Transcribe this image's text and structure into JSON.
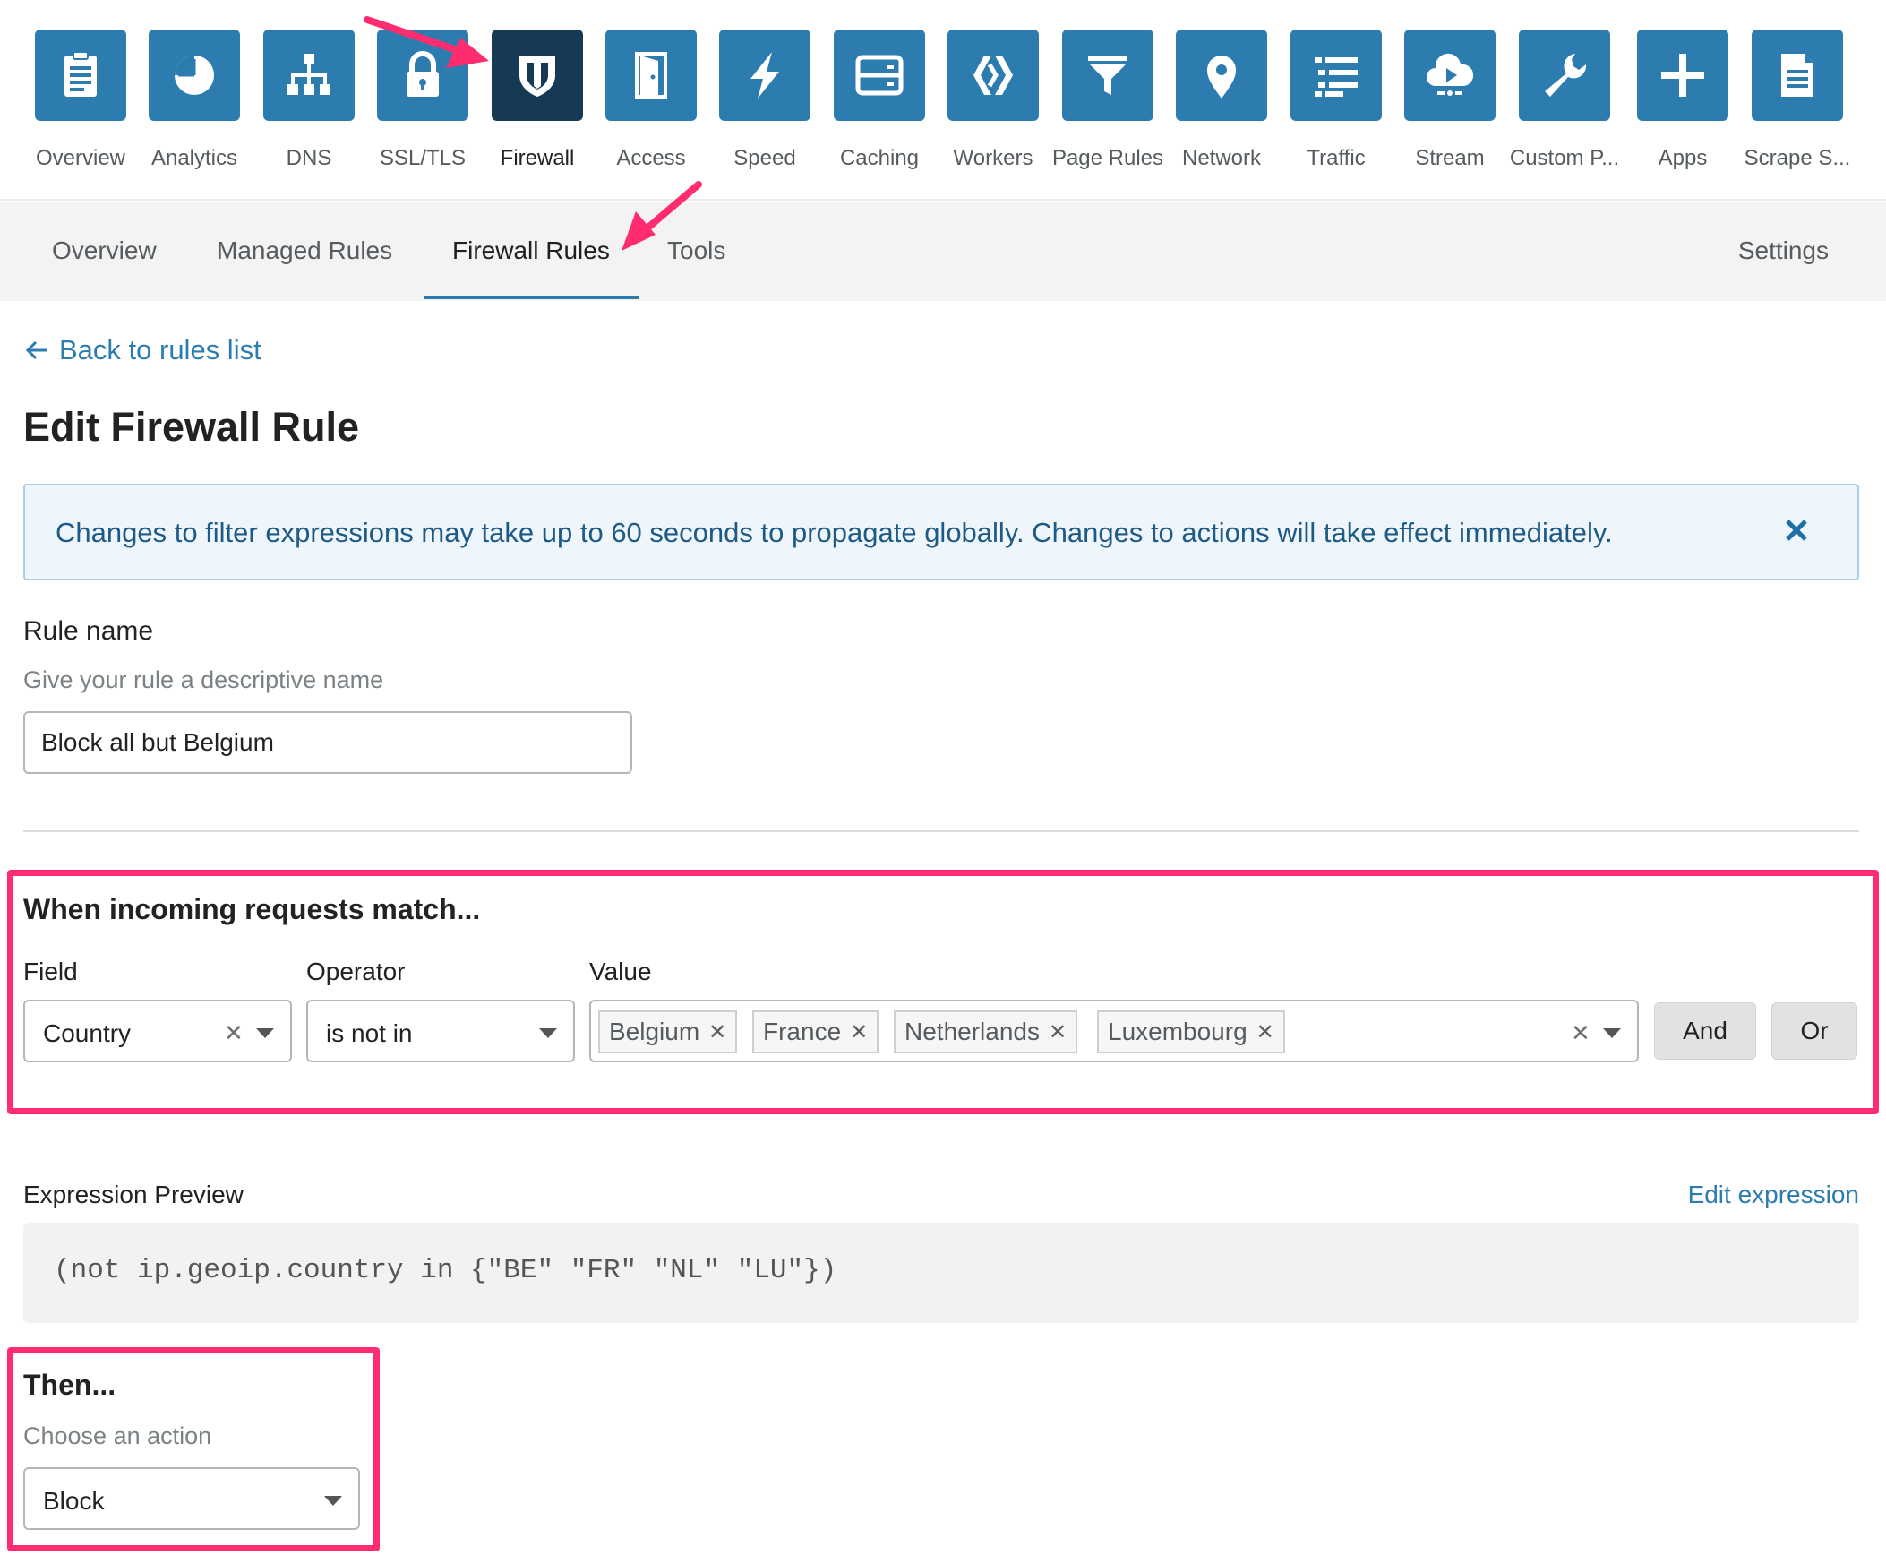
{
  "nav": {
    "items": [
      {
        "label": "Overview",
        "icon": "clipboard-icon"
      },
      {
        "label": "Analytics",
        "icon": "pie-chart-icon"
      },
      {
        "label": "DNS",
        "icon": "network-tree-icon"
      },
      {
        "label": "SSL/TLS",
        "icon": "lock-icon"
      },
      {
        "label": "Firewall",
        "icon": "shield-icon",
        "active": true
      },
      {
        "label": "Access",
        "icon": "door-icon"
      },
      {
        "label": "Speed",
        "icon": "lightning-icon"
      },
      {
        "label": "Caching",
        "icon": "server-icon"
      },
      {
        "label": "Workers",
        "icon": "workers-icon"
      },
      {
        "label": "Page Rules",
        "icon": "filter-icon"
      },
      {
        "label": "Network",
        "icon": "map-pin-icon"
      },
      {
        "label": "Traffic",
        "icon": "list-icon"
      },
      {
        "label": "Stream",
        "icon": "cloud-play-icon"
      },
      {
        "label": "Custom P...",
        "icon": "wrench-icon"
      },
      {
        "label": "Apps",
        "icon": "plus-icon"
      },
      {
        "label": "Scrape S...",
        "icon": "document-icon"
      }
    ]
  },
  "subnav": {
    "tabs": [
      "Overview",
      "Managed Rules",
      "Firewall Rules",
      "Tools"
    ],
    "active": "Firewall Rules",
    "settings": "Settings"
  },
  "back_link": "Back to rules list",
  "page_title": "Edit Firewall Rule",
  "notice": {
    "text": "Changes to filter expressions may take up to 60 seconds to propagate globally. Changes to actions will take effect immediately."
  },
  "rule_name": {
    "label": "Rule name",
    "hint": "Give your rule a descriptive name",
    "value": "Block all but Belgium"
  },
  "match": {
    "title": "When incoming requests match...",
    "field_label": "Field",
    "operator_label": "Operator",
    "value_label": "Value",
    "field": "Country",
    "operator": "is not in",
    "values": [
      "Belgium",
      "France",
      "Netherlands",
      "Luxembourg"
    ],
    "and_label": "And",
    "or_label": "Or"
  },
  "expression": {
    "label": "Expression Preview",
    "edit_label": "Edit expression",
    "code": "(not ip.geoip.country in {\"BE\" \"FR\" \"NL\" \"LU\"})"
  },
  "then": {
    "title": "Then...",
    "hint": "Choose an action",
    "action": "Block"
  },
  "colors": {
    "accent": "#2c7cb0",
    "active_tile": "#163a54",
    "highlight": "#ff2d6f"
  }
}
